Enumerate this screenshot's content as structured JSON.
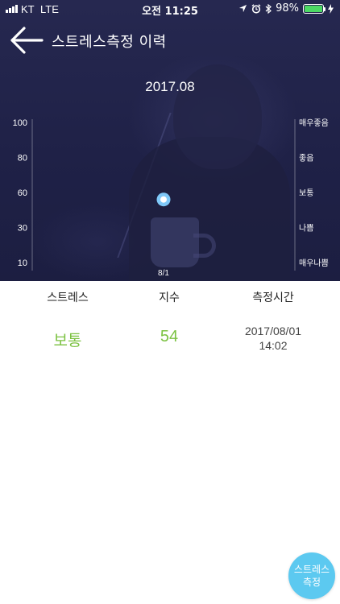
{
  "status_bar": {
    "carrier": "KT",
    "network": "LTE",
    "time": "오전 11:25",
    "battery": "98%",
    "battery_level": 0.98,
    "icons": [
      "location-arrow-icon",
      "alarm-icon",
      "bluetooth-icon",
      "battery-icon",
      "charging-bolt-icon"
    ]
  },
  "header": {
    "title": "스트레스측정 이력",
    "back_icon": "arrow-left-icon"
  },
  "chart_data": {
    "type": "scatter",
    "title": "2017.08",
    "x_ticks": [
      "8/1"
    ],
    "y_ticks": [
      100,
      80,
      60,
      30,
      10
    ],
    "y_right_labels": [
      "매우좋음",
      "좋음",
      "보통",
      "나쁨",
      "매우나쁨"
    ],
    "points": [
      {
        "x": "8/1",
        "y": 54
      }
    ],
    "point_color": "#7fc8f8"
  },
  "table": {
    "headers": [
      "스트레스",
      "지수",
      "측정시간"
    ],
    "rows": [
      {
        "level": "보통",
        "score": "54",
        "date": "2017/08/01",
        "time": "14:02"
      }
    ]
  },
  "fab": {
    "line1": "스트레스",
    "line2": "측정"
  },
  "colors": {
    "accent_green": "#7cc242",
    "fab_blue": "#5cc9f0",
    "hero_bg": "#23254b"
  }
}
